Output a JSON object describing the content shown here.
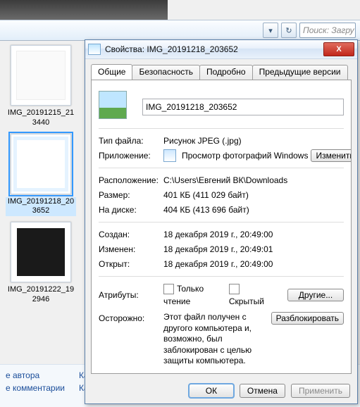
{
  "toolbar": {
    "dropdown_icon": "▾",
    "refresh_icon": "↻",
    "search_placeholder": "Поиск: Загру"
  },
  "thumbs": [
    {
      "name": "IMG_20191215_213440",
      "style": "white",
      "selected": false
    },
    {
      "name": "IMG_20191218_203652",
      "style": "grid",
      "selected": true
    },
    {
      "name": "IMG_20191222_192946",
      "style": "dark",
      "selected": false
    }
  ],
  "footer": {
    "author": "е автора",
    "comments": "е комментарии",
    "cam": "Кам",
    "cam2": "Кате"
  },
  "dialog": {
    "title": "Свойства: IMG_20191218_203652",
    "close": "X",
    "tabs": [
      "Общие",
      "Безопасность",
      "Подробно",
      "Предыдущие версии"
    ],
    "filename": "IMG_20191218_203652",
    "rows": {
      "filetype_lbl": "Тип файла:",
      "filetype_val": "Рисунок JPEG (.jpg)",
      "app_lbl": "Приложение:",
      "app_val": "Просмотр фотографий Windows",
      "change_btn": "Изменить...",
      "location_lbl": "Расположение:",
      "location_val": "C:\\Users\\Евгений ВК\\Downloads",
      "size_lbl": "Размер:",
      "size_val": "401 КБ (411 029 байт)",
      "ondisk_lbl": "На диске:",
      "ondisk_val": "404 КБ (413 696 байт)",
      "created_lbl": "Создан:",
      "created_val": "18 декабря 2019 г., 20:49:00",
      "modified_lbl": "Изменен:",
      "modified_val": "18 декабря 2019 г., 20:49:01",
      "accessed_lbl": "Открыт:",
      "accessed_val": "18 декабря 2019 г., 20:49:00",
      "attr_lbl": "Атрибуты:",
      "readonly": "Только чтение",
      "hidden": "Скрытый",
      "other_btn": "Другие...",
      "warn_lbl": "Осторожно:",
      "warn_val": "Этот файл получен с другого компьютера и, возможно, был заблокирован с целью защиты компьютера.",
      "unblock_btn": "Разблокировать"
    },
    "buttons": {
      "ok": "ОК",
      "cancel": "Отмена",
      "apply": "Применить"
    }
  }
}
